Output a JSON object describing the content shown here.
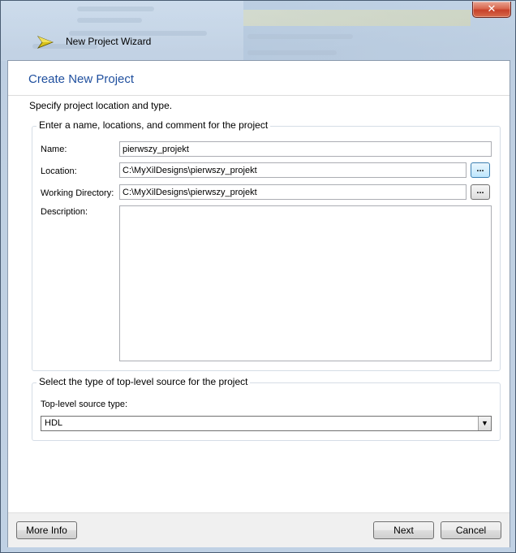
{
  "window": {
    "title": "New Project Wizard",
    "close_glyph": "✕",
    "app_icon": "xilinx-wizard-arrow-icon"
  },
  "page": {
    "heading": "Create New Project",
    "subtitle": "Specify project location and type."
  },
  "project_group": {
    "legend": "Enter a name, locations, and comment for the project",
    "name_label": "Name:",
    "name_value": "pierwszy_projekt",
    "location_label": "Location:",
    "location_value": "C:\\MyXilDesigns\\pierwszy_projekt",
    "workdir_label": "Working Directory:",
    "workdir_value": "C:\\MyXilDesigns\\pierwszy_projekt",
    "description_label": "Description:",
    "description_value": "",
    "browse_label": "..."
  },
  "source_group": {
    "legend": "Select the type of top-level source for the project",
    "type_label": "Top-level source type:",
    "type_value": "HDL"
  },
  "footer": {
    "more_info": "More Info",
    "next": "Next",
    "cancel": "Cancel"
  },
  "colors": {
    "heading": "#1f4f9e",
    "close_button": "#c7412a",
    "icon_yellow": "#d8c21a"
  }
}
